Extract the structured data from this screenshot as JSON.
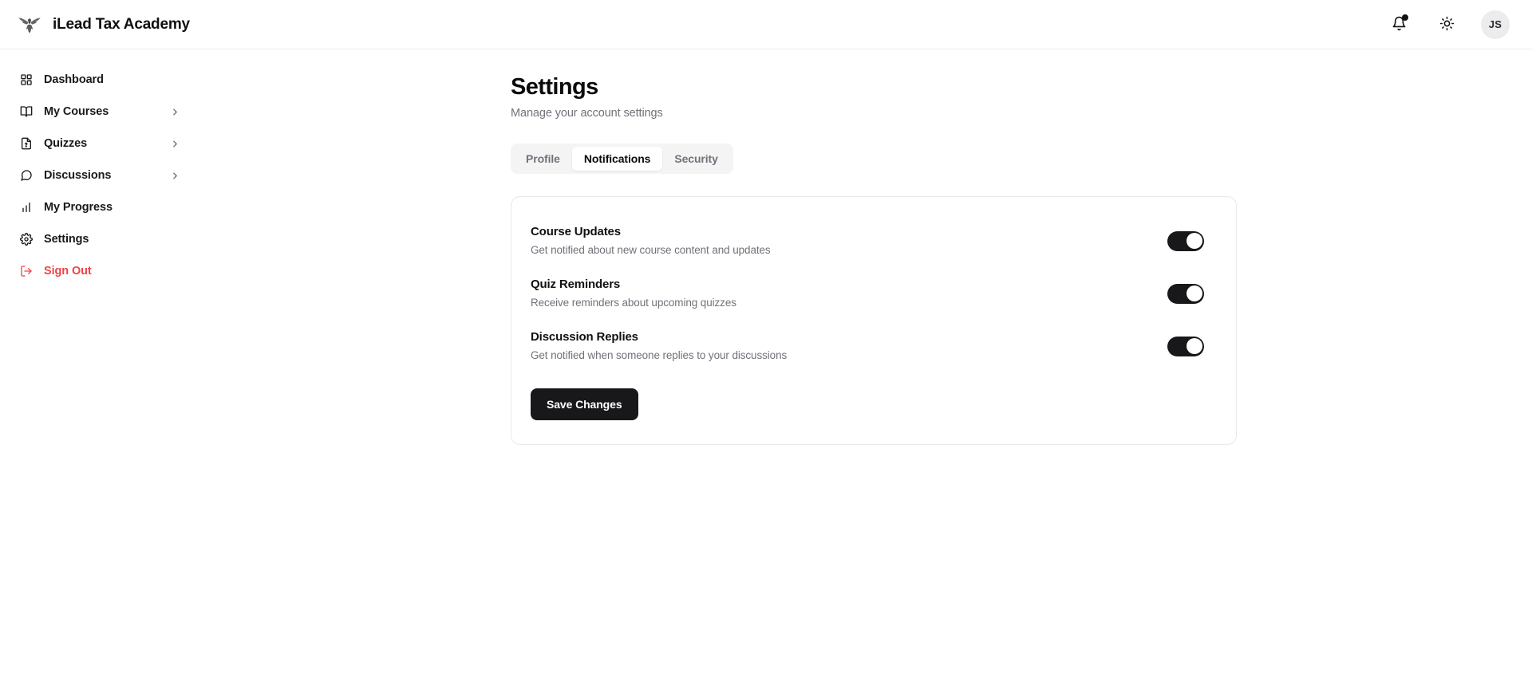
{
  "header": {
    "brand_name": "iLead Tax Academy",
    "logo_icon": "eagle-logo-icon",
    "notifications_icon": "bell-icon",
    "theme_icon": "sun-icon",
    "avatar_initials": "JS",
    "has_notification_dot": true
  },
  "sidebar": {
    "items": [
      {
        "label": "Dashboard",
        "icon": "grid-icon",
        "has_chevron": false,
        "danger": false
      },
      {
        "label": "My Courses",
        "icon": "book-icon",
        "has_chevron": true,
        "danger": false
      },
      {
        "label": "Quizzes",
        "icon": "file-question-icon",
        "has_chevron": true,
        "danger": false
      },
      {
        "label": "Discussions",
        "icon": "message-icon",
        "has_chevron": true,
        "danger": false
      },
      {
        "label": "My Progress",
        "icon": "bar-chart-icon",
        "has_chevron": false,
        "danger": false
      },
      {
        "label": "Settings",
        "icon": "gear-icon",
        "has_chevron": false,
        "danger": false
      },
      {
        "label": "Sign Out",
        "icon": "logout-icon",
        "has_chevron": false,
        "danger": true
      }
    ]
  },
  "main": {
    "title": "Settings",
    "subtitle": "Manage your account settings",
    "tabs": [
      {
        "label": "Profile",
        "active": false
      },
      {
        "label": "Notifications",
        "active": true
      },
      {
        "label": "Security",
        "active": false
      }
    ],
    "notification_settings": [
      {
        "title": "Course Updates",
        "description": "Get notified about new course content and updates",
        "enabled": true
      },
      {
        "title": "Quiz Reminders",
        "description": "Receive reminders about upcoming quizzes",
        "enabled": true
      },
      {
        "title": "Discussion Replies",
        "description": "Get notified when someone replies to your discussions",
        "enabled": true
      }
    ],
    "save_label": "Save Changes"
  },
  "colors": {
    "accent": "#18181b",
    "danger": "#ef4444",
    "muted": "#71717a",
    "border": "#e9e9ec",
    "track": "#f4f4f5"
  }
}
